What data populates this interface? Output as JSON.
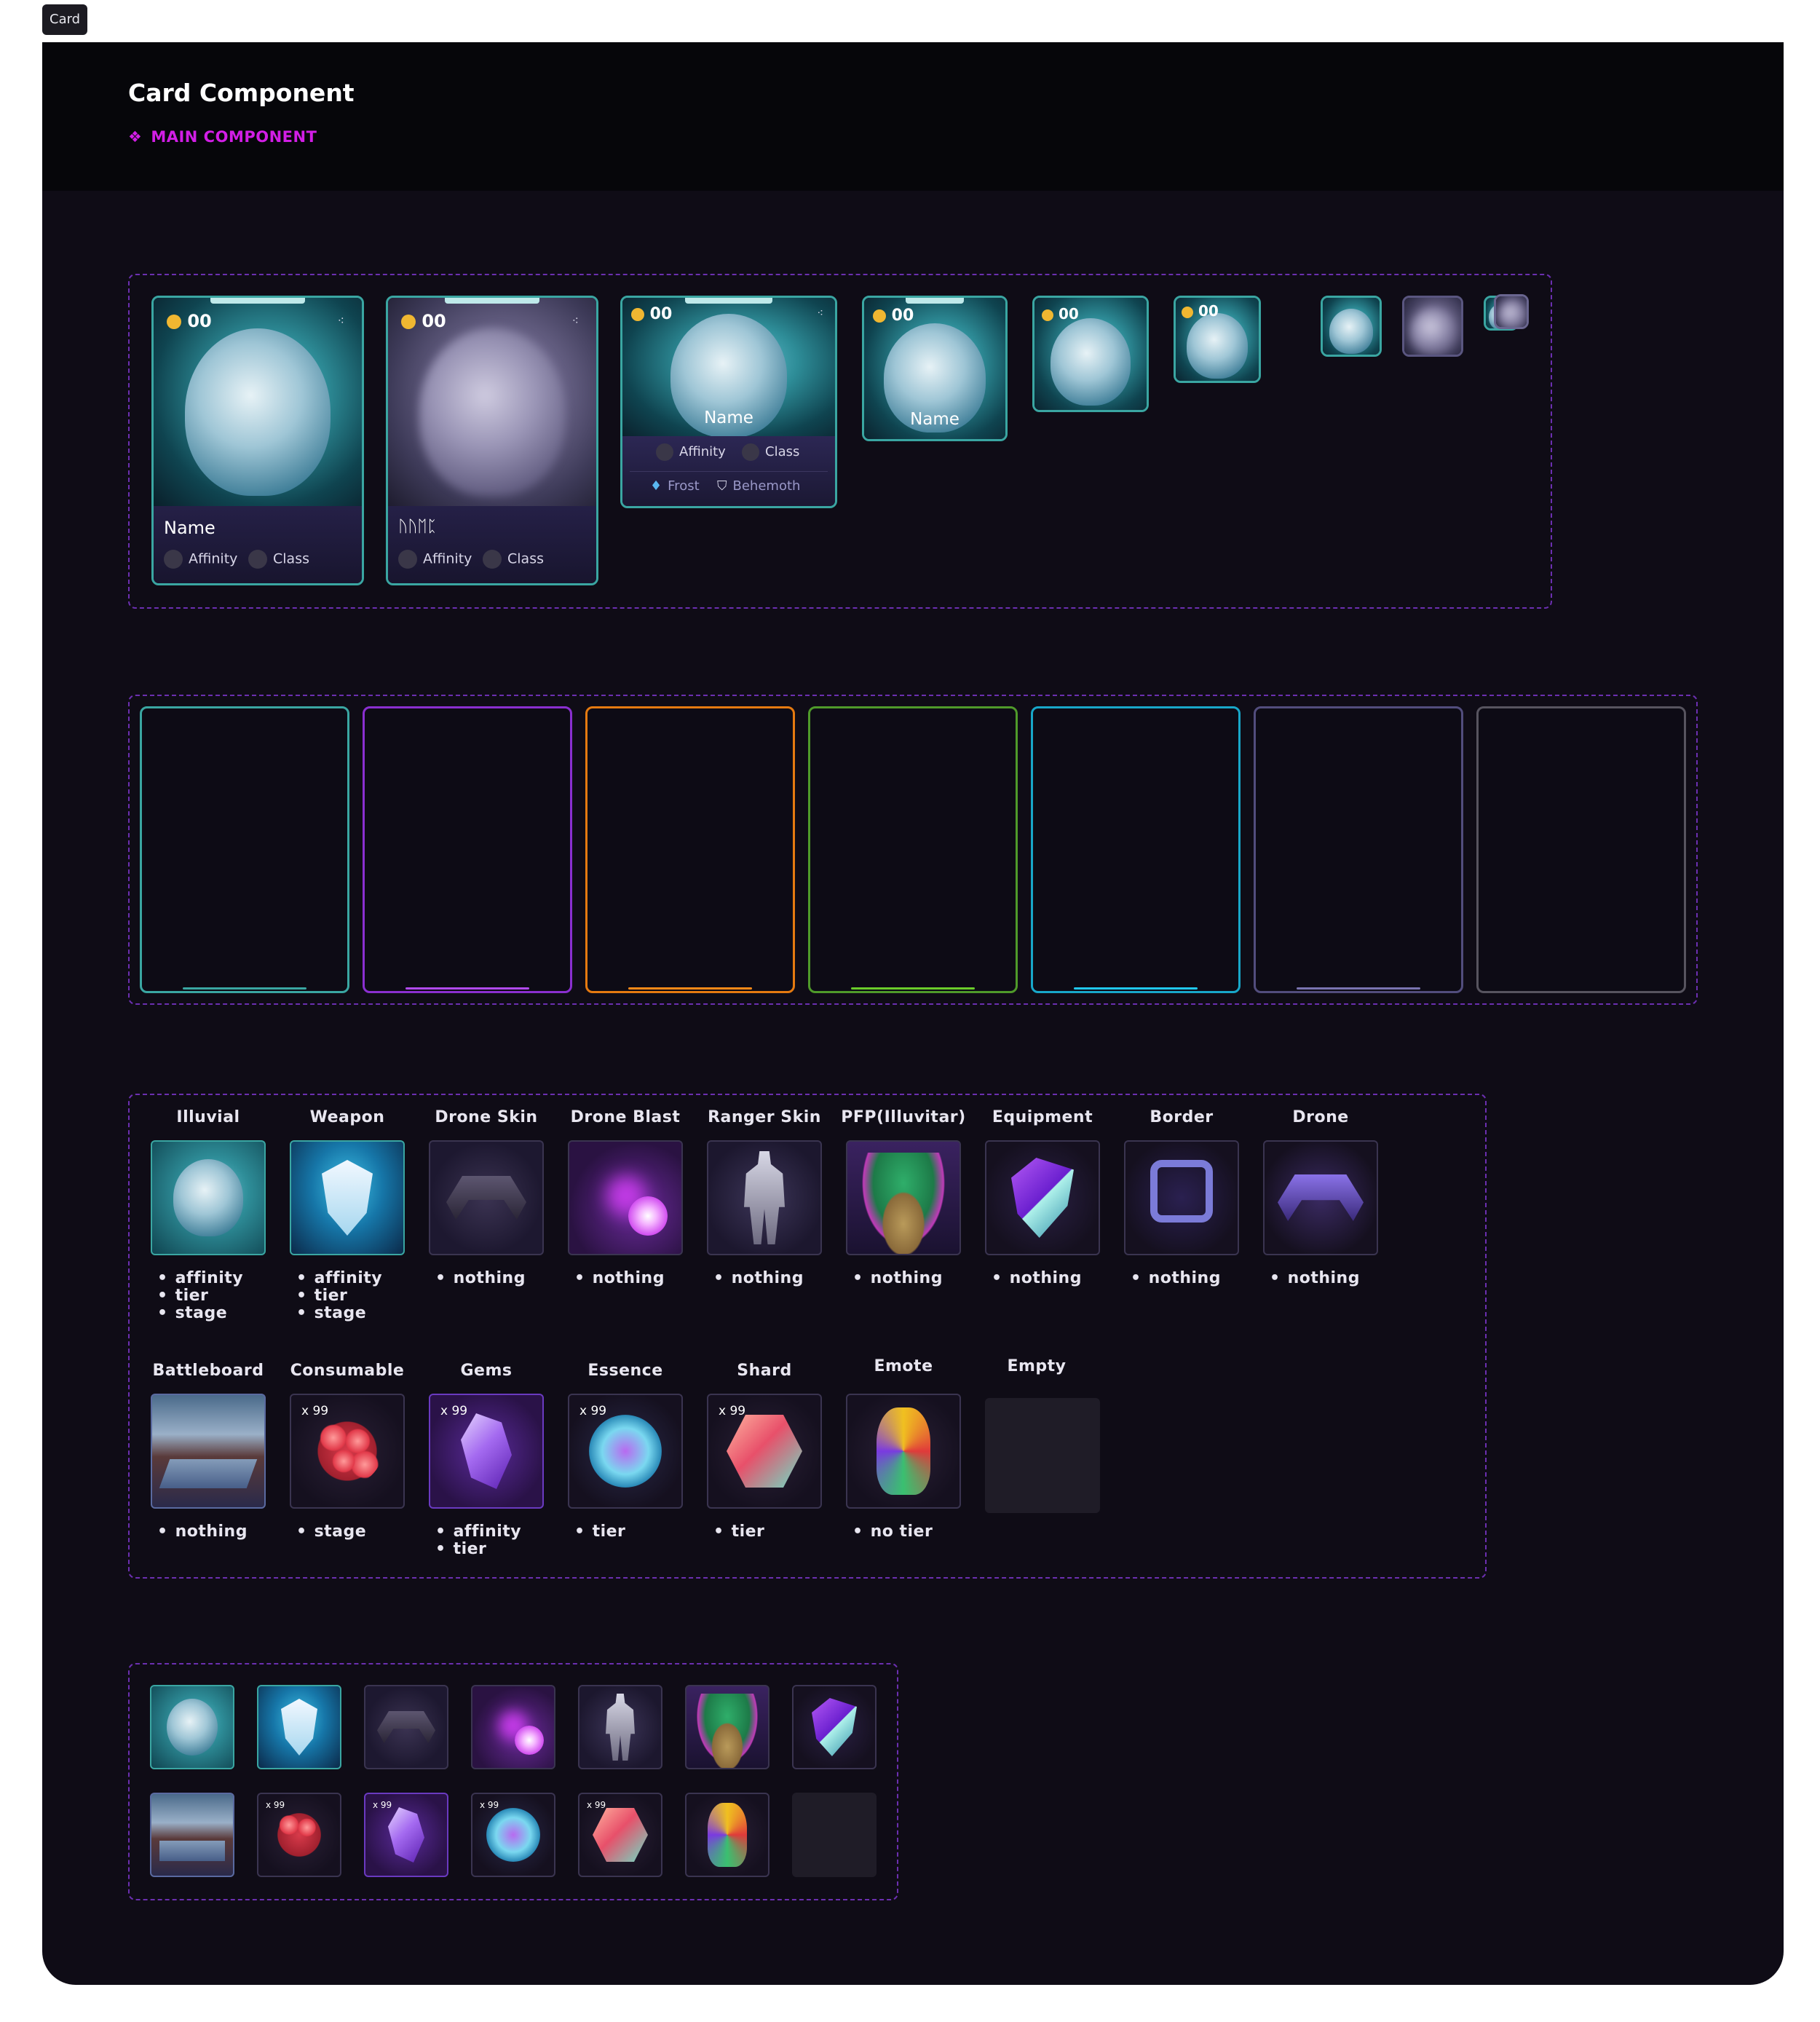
{
  "top_badge": "Card",
  "header": {
    "title": "Card Component",
    "subtitle": "MAIN COMPONENT"
  },
  "cards": {
    "cost": "00",
    "name": "Name",
    "alien_name": "ᚢᚢᛖᛈ",
    "affinity": "Affinity",
    "class": "Class",
    "frost": "Frost",
    "behemoth": "Behemoth"
  },
  "frames": {
    "colors": [
      "#3aa6a2",
      "#8a2fd0",
      "#e57a10",
      "#4f9a2a",
      "#18a7c9",
      "#524d7d",
      "#57545f"
    ]
  },
  "categories": {
    "row1": [
      {
        "label": "Illuvial",
        "bullets": [
          "affinity",
          "tier",
          "stage"
        ],
        "icon": "bear-icon"
      },
      {
        "label": "Weapon",
        "bullets": [
          "affinity",
          "tier",
          "stage"
        ],
        "icon": "shield-icon"
      },
      {
        "label": "Drone Skin",
        "bullets": [
          "nothing"
        ],
        "icon": "drone-icon"
      },
      {
        "label": "Drone Blast",
        "bullets": [
          "nothing"
        ],
        "icon": "comet-icon"
      },
      {
        "label": "Ranger Skin",
        "bullets": [
          "nothing"
        ],
        "icon": "robot-icon"
      },
      {
        "label": "PFP(Illuvitar)",
        "bullets": [
          "nothing"
        ],
        "icon": "llama-icon"
      },
      {
        "label": "Equipment",
        "bullets": [
          "nothing"
        ],
        "icon": "gem-shield-icon"
      },
      {
        "label": "Border",
        "bullets": [
          "nothing"
        ],
        "icon": "border-frame-icon"
      },
      {
        "label": "Drone",
        "bullets": [
          "nothing"
        ],
        "icon": "drone-icon"
      }
    ],
    "row2": [
      {
        "label": "Battleboard",
        "bullets": [
          "nothing"
        ],
        "icon": "landscape-icon",
        "qty": ""
      },
      {
        "label": "Consumable",
        "bullets": [
          "stage"
        ],
        "icon": "berries-icon",
        "qty": "x 99"
      },
      {
        "label": "Gems",
        "bullets": [
          "affinity",
          "tier"
        ],
        "icon": "crystal-icon",
        "qty": "x 99"
      },
      {
        "label": "Essence",
        "bullets": [
          "tier"
        ],
        "icon": "orb-icon",
        "qty": "x 99"
      },
      {
        "label": "Shard",
        "bullets": [
          "tier"
        ],
        "icon": "shard-icon",
        "qty": "x 99"
      },
      {
        "label": "Emote",
        "bullets": [
          "no tier"
        ],
        "icon": "emote-icon",
        "qty": ""
      },
      {
        "label": "Empty",
        "bullets": [],
        "icon": "",
        "qty": ""
      }
    ]
  },
  "mini_qty": "x 99",
  "colors": {
    "accent": "#d21ee6",
    "dashed": "#6b2fb0",
    "teal": "#3aa6a2",
    "coin": "#f0b731"
  }
}
